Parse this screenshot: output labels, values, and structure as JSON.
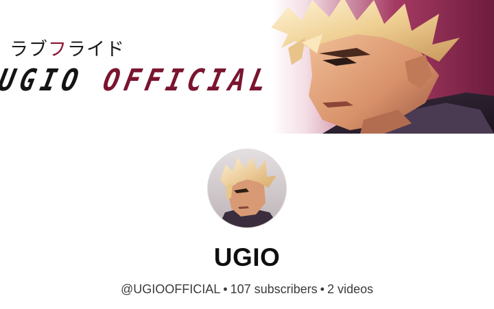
{
  "banner": {
    "jp_text_a": "ラブ",
    "jp_text_b": "フ",
    "jp_text_c": "ライド",
    "title_a": "UGIO ",
    "title_b": "OFFICIAL"
  },
  "channel": {
    "name": "UGIO",
    "handle": "@UGIOOFFICIAL",
    "separator": "•",
    "subscribers": "107 subscribers",
    "videos": "2 videos"
  },
  "colors": {
    "banner_accent": "#8b1630",
    "text_primary": "#0f0f0f",
    "text_secondary": "#3a3a3a"
  },
  "icons": {
    "avatar": "character-portrait-avatar"
  }
}
